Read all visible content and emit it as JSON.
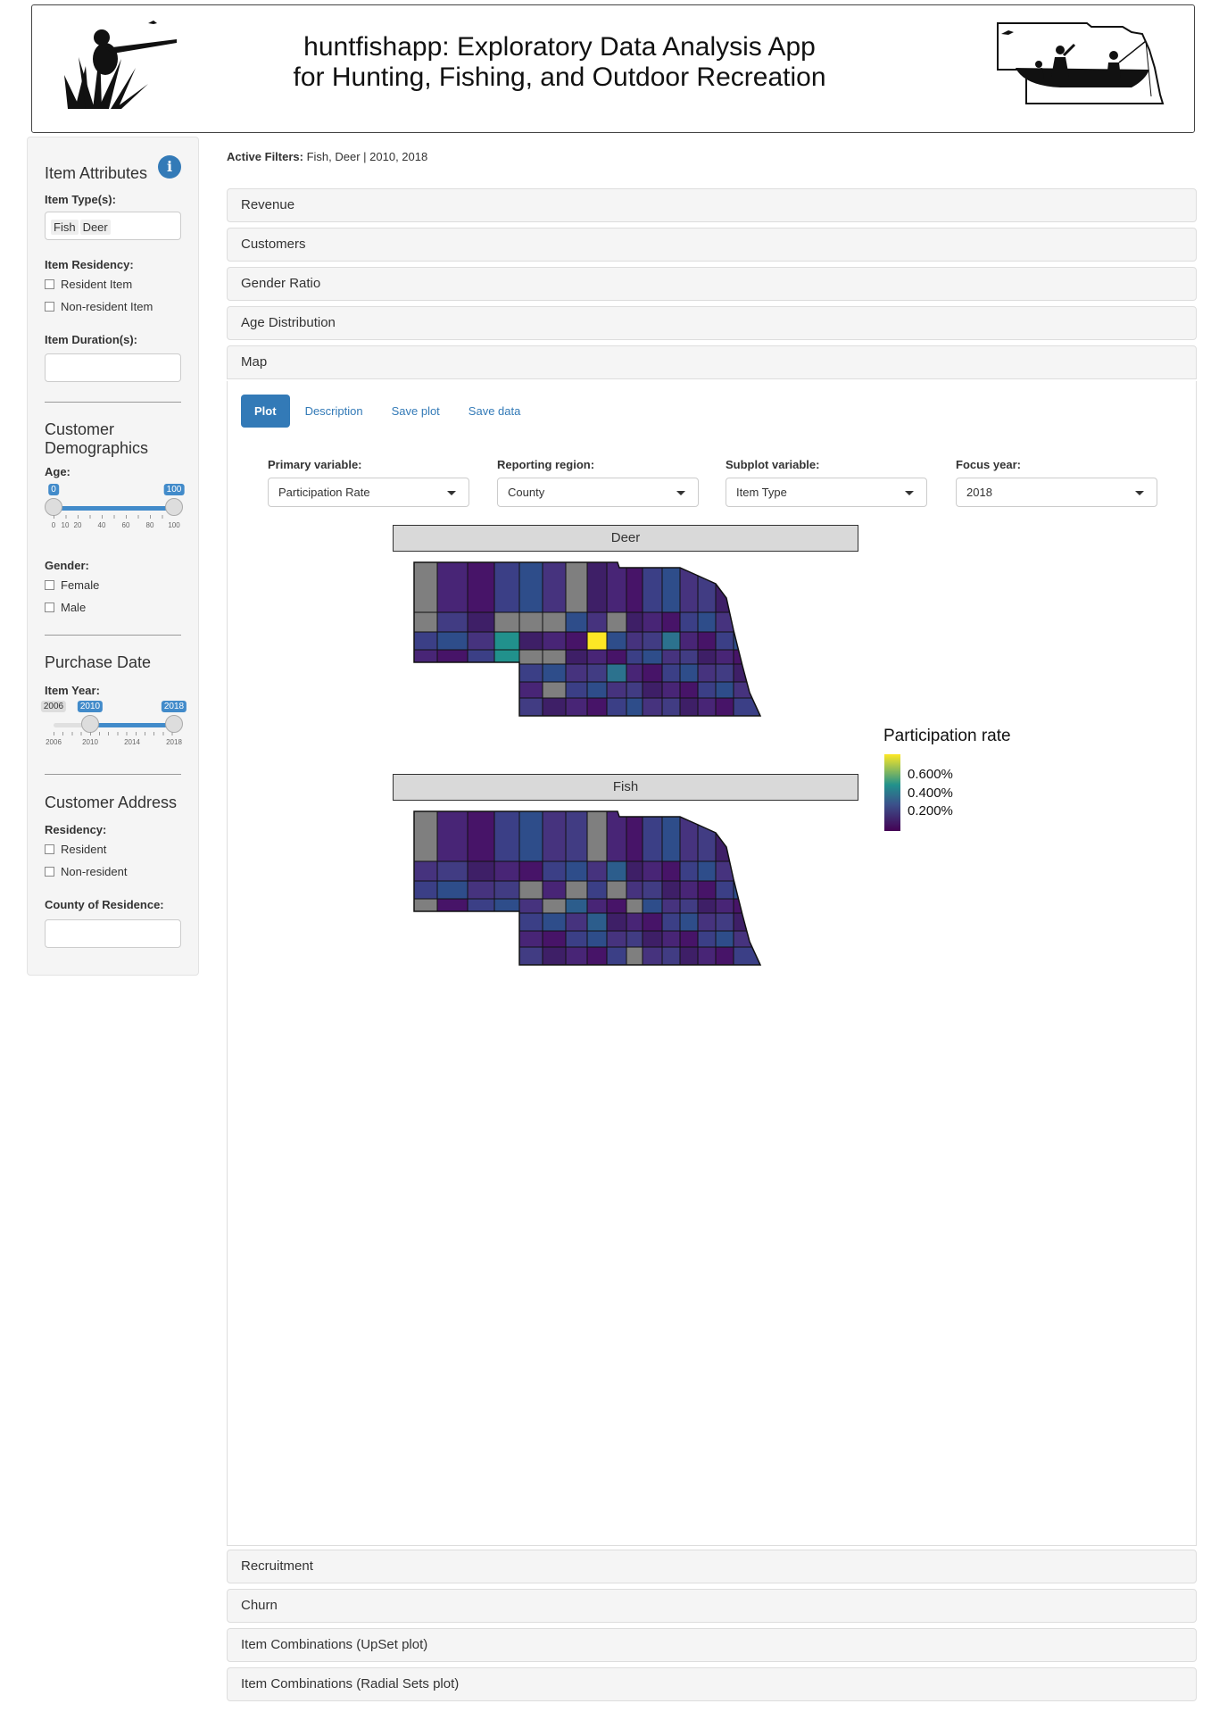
{
  "header": {
    "title_line1": "huntfishapp: Exploratory Data Analysis App",
    "title_line2": "for Hunting, Fishing, and Outdoor Recreation"
  },
  "sidebar": {
    "item_attributes": {
      "heading": "Item Attributes",
      "item_types_label": "Item Type(s):",
      "item_types": [
        "Fish",
        "Deer"
      ],
      "residency_label": "Item Residency:",
      "residency_options": [
        "Resident Item",
        "Non-resident Item"
      ],
      "duration_label": "Item Duration(s):"
    },
    "customer_demographics": {
      "heading": "Customer Demographics",
      "age_label": "Age:",
      "age_min": "0",
      "age_max": "100",
      "age_ticks": [
        "0",
        "10",
        "20",
        "40",
        "60",
        "80",
        "100"
      ],
      "gender_label": "Gender:",
      "gender_options": [
        "Female",
        "Male"
      ]
    },
    "purchase_date": {
      "heading": "Purchase Date",
      "item_year_label": "Item Year:",
      "range_min": "2006",
      "from": "2010",
      "to": "2018",
      "ticks": [
        "2006",
        "2010",
        "2014",
        "2018"
      ]
    },
    "customer_address": {
      "heading": "Customer Address",
      "residency_label": "Residency:",
      "residency_options": [
        "Resident",
        "Non-resident"
      ],
      "county_label": "County of Residence:"
    }
  },
  "main": {
    "active_filters_label": "Active Filters:",
    "active_filters_value": " Fish, Deer | 2010, 2018",
    "panels_top": [
      "Revenue",
      "Customers",
      "Gender Ratio",
      "Age Distribution",
      "Map"
    ],
    "panels_bottom": [
      "Recruitment",
      "Churn",
      "Item Combinations (UpSet plot)",
      "Item Combinations (Radial Sets plot)"
    ],
    "tabs": [
      "Plot",
      "Description",
      "Save plot",
      "Save data"
    ],
    "selects": [
      {
        "label": "Primary variable:",
        "value": "Participation Rate"
      },
      {
        "label": "Reporting region:",
        "value": "County"
      },
      {
        "label": "Subplot variable:",
        "value": "Item Type"
      },
      {
        "label": "Focus year:",
        "value": "2018"
      }
    ]
  },
  "chart_data": {
    "type": "map",
    "facets": [
      "Deer",
      "Fish"
    ],
    "legend_title": "Participation rate",
    "legend_labels": [
      "0.600%",
      "0.400%",
      "0.200%"
    ],
    "colors": {
      "high": "#fde725",
      "mid": "#21918c",
      "low": "#440154",
      "na": "#7f7f7f"
    }
  }
}
